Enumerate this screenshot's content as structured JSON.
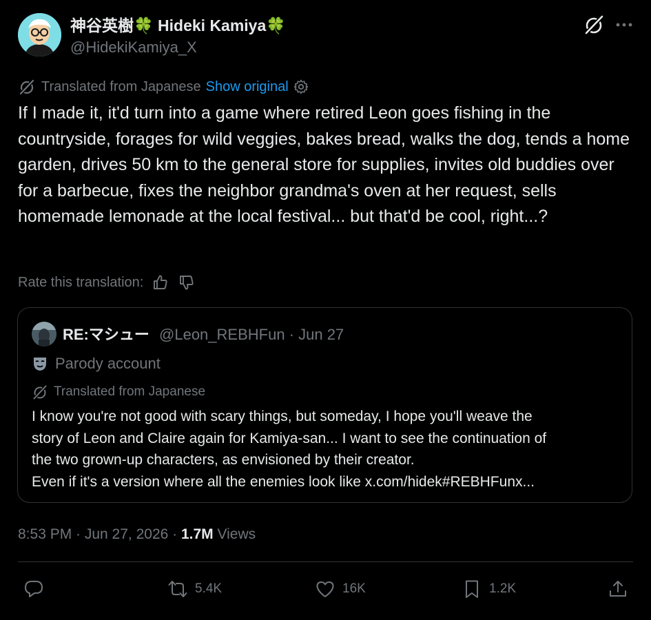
{
  "author": {
    "display_name": "神谷英樹🍀 Hideki Kamiya🍀",
    "handle": "@HidekiKamiya_X",
    "avatar_icon": "cartoon-avatar-icon"
  },
  "header_icons": {
    "grok": "grok-icon",
    "more": "more-icon"
  },
  "translation": {
    "notice": "Translated from Japanese",
    "show_original": "Show original"
  },
  "tweet": {
    "text": "If I made it, it'd turn into a game where retired Leon goes fishing in the countryside, forages for wild veggies, bakes bread, walks the dog, tends a home garden, drives 50 km to the general store for supplies, invites old buddies over for a barbecue, fixes the neighbor grandma's oven at her request, sells homemade lemonade at the local festival... but that'd be cool, right...?"
  },
  "rate": {
    "label": "Rate this translation:"
  },
  "quote": {
    "name": "RE:マシュー",
    "handle_date": "@Leon_REBHFun · Jun 27",
    "parody_label": "Parody account",
    "translation_notice": "Translated from Japanese",
    "lines": [
      "I know you're not good with scary things, but someday, I hope you'll weave the",
      "story of Leon and Claire again for Kamiya-san... I want to see the continuation of",
      "the two grown-up characters, as envisioned by their creator.",
      "Even if it's a version where all the enemies look like x.com/hidek#REBHFunx..."
    ]
  },
  "meta": {
    "time_date": "8:53 PM · Jun 27, 2026 · ",
    "views_count": "1.7M",
    "views_label": " Views"
  },
  "actions": {
    "reposts": "5.4K",
    "likes": "16K",
    "bookmarks": "1.2K"
  },
  "colors": {
    "background": "#000000",
    "text": "#e7e9ea",
    "secondary": "#71767b",
    "link": "#1d9bf0",
    "border": "#2f3336",
    "avatar_bg": "#7fdde6"
  }
}
